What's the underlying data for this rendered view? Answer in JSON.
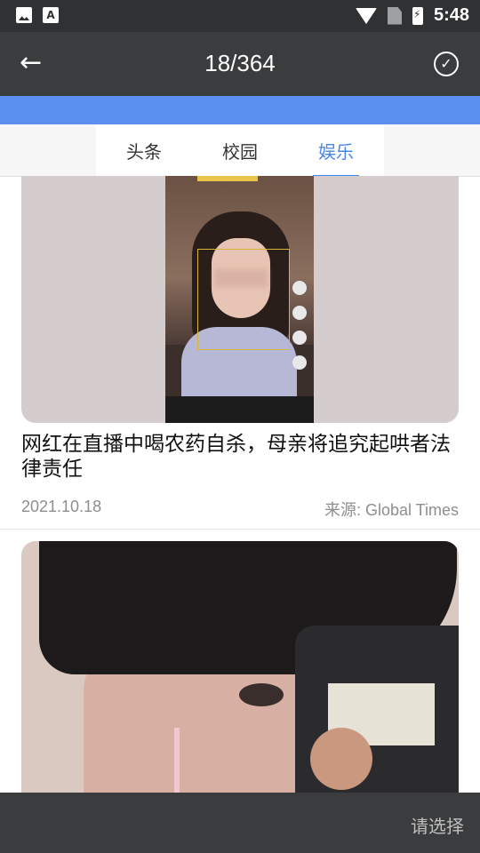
{
  "status_bar": {
    "time": "5:48",
    "icons": [
      "image-icon",
      "text-a-icon",
      "wifi-icon",
      "no-sim-icon",
      "battery-charging-icon"
    ]
  },
  "app_bar": {
    "title": "18/364",
    "back_icon": "arrow-left",
    "confirm_icon": "check-circle"
  },
  "tabs": [
    {
      "label": "头条",
      "active": false
    },
    {
      "label": "校园",
      "active": false
    },
    {
      "label": "娱乐",
      "active": true
    }
  ],
  "articles": [
    {
      "headline": "网红在直播中喝农药自杀，母亲将追究起哄者法律责任",
      "date": "2021.10.18",
      "source": "来源: Global Times"
    }
  ],
  "bottom_bar": {
    "action_label": "请选择"
  },
  "colors": {
    "accent": "#4a86e8",
    "blue_band": "#5b8ff0",
    "bar_dark": "#3a3c3e"
  }
}
